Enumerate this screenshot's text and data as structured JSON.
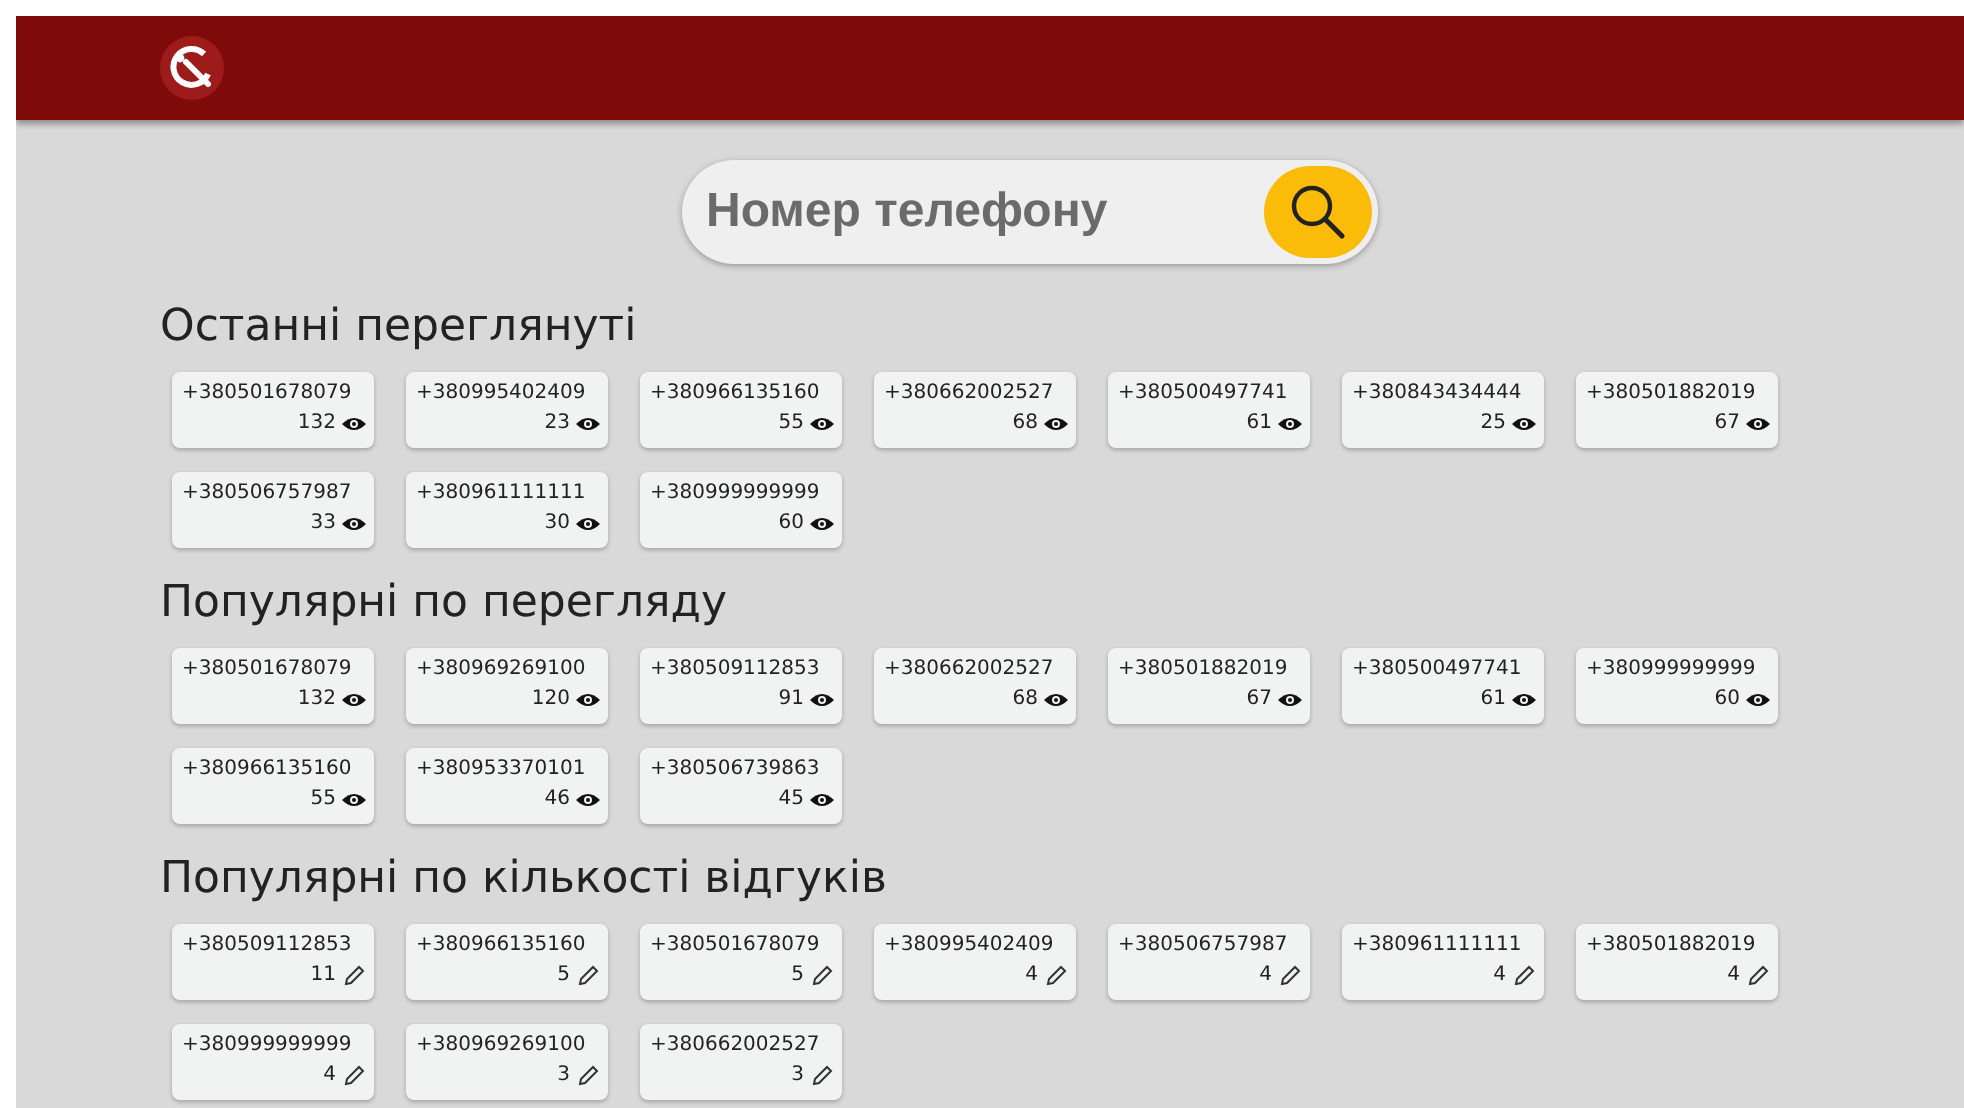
{
  "search": {
    "placeholder": "Номер телефону"
  },
  "sections": [
    {
      "title": "Останні переглянуті",
      "kind": "views",
      "cards": [
        {
          "phone": "+380501678079",
          "count": "132"
        },
        {
          "phone": "+380995402409",
          "count": "23"
        },
        {
          "phone": "+380966135160",
          "count": "55"
        },
        {
          "phone": "+380662002527",
          "count": "68"
        },
        {
          "phone": "+380500497741",
          "count": "61"
        },
        {
          "phone": "+380843434444",
          "count": "25"
        },
        {
          "phone": "+380501882019",
          "count": "67"
        },
        {
          "phone": "+380506757987",
          "count": "33"
        },
        {
          "phone": "+380961111111",
          "count": "30"
        },
        {
          "phone": "+380999999999",
          "count": "60"
        }
      ]
    },
    {
      "title": "Популярні по перегляду",
      "kind": "views",
      "cards": [
        {
          "phone": "+380501678079",
          "count": "132"
        },
        {
          "phone": "+380969269100",
          "count": "120"
        },
        {
          "phone": "+380509112853",
          "count": "91"
        },
        {
          "phone": "+380662002527",
          "count": "68"
        },
        {
          "phone": "+380501882019",
          "count": "67"
        },
        {
          "phone": "+380500497741",
          "count": "61"
        },
        {
          "phone": "+380999999999",
          "count": "60"
        },
        {
          "phone": "+380966135160",
          "count": "55"
        },
        {
          "phone": "+380953370101",
          "count": "46"
        },
        {
          "phone": "+380506739863",
          "count": "45"
        }
      ]
    },
    {
      "title": "Популярні по кількості відгуків",
      "kind": "reviews",
      "cards": [
        {
          "phone": "+380509112853",
          "count": "11"
        },
        {
          "phone": "+380966135160",
          "count": "5"
        },
        {
          "phone": "+380501678079",
          "count": "5"
        },
        {
          "phone": "+380995402409",
          "count": "4"
        },
        {
          "phone": "+380506757987",
          "count": "4"
        },
        {
          "phone": "+380961111111",
          "count": "4"
        },
        {
          "phone": "+380501882019",
          "count": "4"
        },
        {
          "phone": "+380999999999",
          "count": "4"
        },
        {
          "phone": "+380969269100",
          "count": "3"
        },
        {
          "phone": "+380662002527",
          "count": "3"
        }
      ]
    }
  ]
}
